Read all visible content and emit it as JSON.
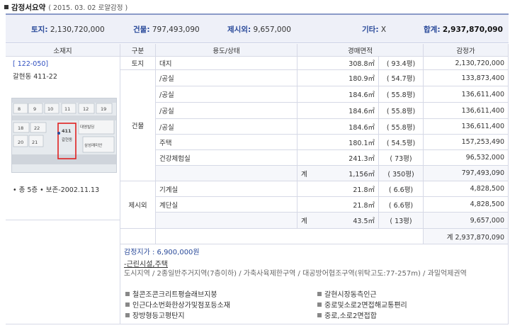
{
  "header": {
    "title": "감정서요약",
    "subtitle": "( 2015. 03. 02  로얄감정 )"
  },
  "summary": {
    "land": {
      "label": "토지:",
      "value": "2,130,720,000"
    },
    "building": {
      "label": "건물:",
      "value": "797,493,090"
    },
    "external": {
      "label": "제시외:",
      "value": "9,657,000"
    },
    "other": {
      "label": "기타:",
      "value": "X"
    },
    "total": {
      "label": "합계:",
      "value": "2,937,870,090"
    }
  },
  "table": {
    "headers": {
      "location": "소재지",
      "category": "구분",
      "use": "용도/상태",
      "area": "경매면적",
      "price": "감정가"
    },
    "location": {
      "code": "[ 122-050]",
      "address": "갈현동 411-22",
      "floors": "• 총 5층   • 보존-2002.11.13"
    },
    "map": {
      "parcels": [
        "8",
        "9",
        "10",
        "11",
        "12",
        "19",
        "18",
        "22",
        "20",
        "21",
        "411"
      ],
      "labels": [
        "대영빌딩",
        "갈현동",
        "삼성래미안"
      ]
    },
    "groups": {
      "land": "토지",
      "building": "건물",
      "external": "제시외"
    },
    "rows": [
      {
        "use": "대지",
        "area": "308.8㎡",
        "pyeong": "( 93.4평)",
        "price": "2,130,720,000"
      },
      {
        "use": "/공실",
        "area": "180.9㎡",
        "pyeong": "( 54.7평)",
        "price": "133,873,400"
      },
      {
        "use": "/공실",
        "area": "184.6㎡",
        "pyeong": "( 55.8평)",
        "price": "136,611,400"
      },
      {
        "use": "/공실",
        "area": "184.6㎡",
        "pyeong": "( 55.8평)",
        "price": "136,611,400"
      },
      {
        "use": "/공실",
        "area": "184.6㎡",
        "pyeong": "( 55.8평)",
        "price": "136,611,400"
      },
      {
        "use": "주택",
        "area": "180.1㎡",
        "pyeong": "( 54.5평)",
        "price": "157,253,490"
      },
      {
        "use": "건강체험실",
        "area": "241.3㎡",
        "pyeong": "( 73평)",
        "price": "96,532,000"
      }
    ],
    "building_subtotal": {
      "label": "계",
      "area": "1,156㎡",
      "pyeong": "( 350평)",
      "price": "797,493,090"
    },
    "external_rows": [
      {
        "use": "기계실",
        "area": "21.8㎡",
        "pyeong": "( 6.6평)",
        "price": "4,828,500"
      },
      {
        "use": "계단실",
        "area": "21.8㎡",
        "pyeong": "( 6.6평)",
        "price": "4,828,500"
      }
    ],
    "external_subtotal": {
      "label": "계",
      "area": "43.5㎡",
      "pyeong": "( 13평)",
      "price": "9,657,000"
    },
    "grand_total": "계  2,937,870,090"
  },
  "details": {
    "appraisal": "감정지가 : 6,900,000원",
    "use": "-근린시설,주택",
    "zone": "도시지역 / 2종일반주거지역(7층이하) / 가축사육제한구역 / 대공방어협조구역(위탁고도:77-257m) / 과밀억제권역",
    "features": [
      "철콘조콘크리트평슬래브지붕",
      "갈현시장동측인근",
      "인근다소번화한상가및점포등소재",
      "중로및소로2면접해교통편리",
      "장방형등고평탄지",
      "중로,소로2면접합"
    ]
  },
  "colors": {
    "accent": "#2a4a9a",
    "link": "#3050c0",
    "header_bg": "#f1f3f9",
    "summary_bg": "#eef0f8"
  }
}
